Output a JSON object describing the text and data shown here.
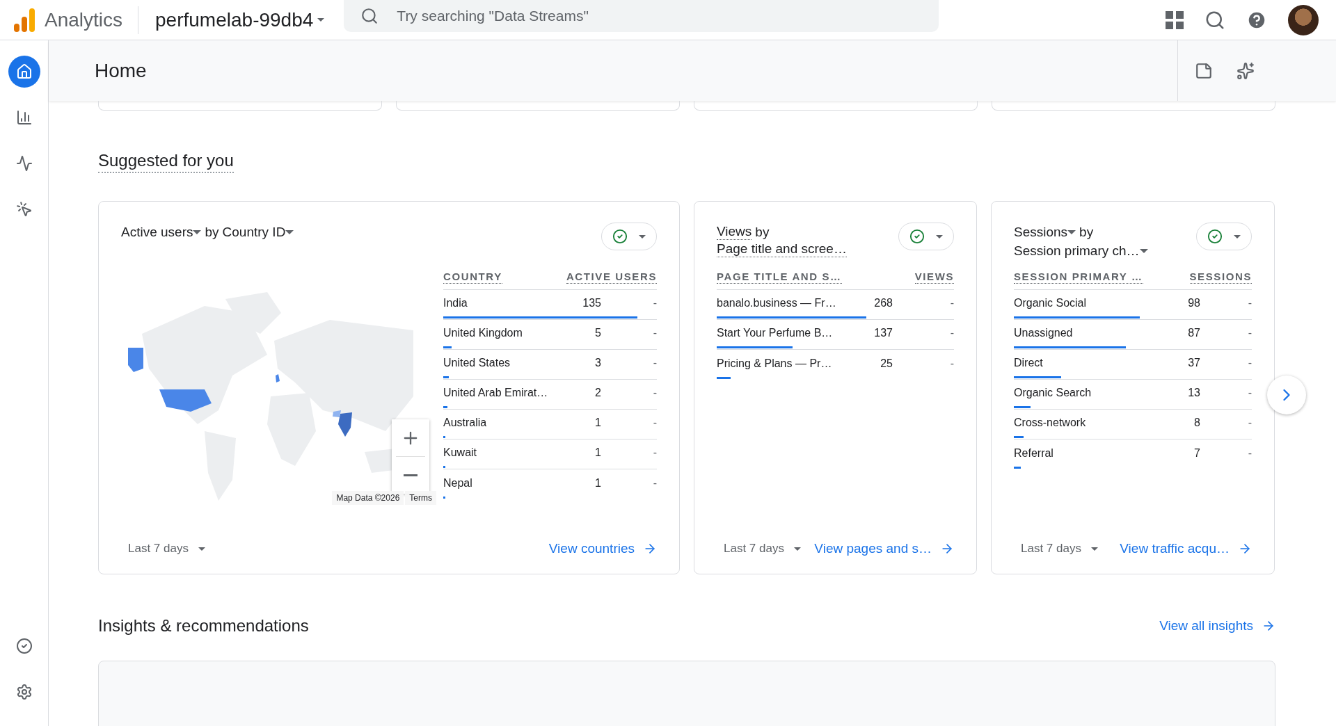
{
  "app": {
    "product": "Analytics",
    "property": "perfumelab-99db4"
  },
  "search": {
    "placeholder": "Try searching \"Data Streams\""
  },
  "rail": {
    "items": [
      {
        "kind": "home",
        "selected": true
      },
      {
        "kind": "reports",
        "selected": false
      },
      {
        "kind": "explore",
        "selected": false
      },
      {
        "kind": "advertising",
        "selected": false
      }
    ],
    "bottom": [
      {
        "kind": "admin-check",
        "selected": false
      },
      {
        "kind": "settings",
        "selected": false
      }
    ]
  },
  "page": {
    "title": "Home"
  },
  "suggested": {
    "heading": "Suggested for you",
    "cards": [
      {
        "kind": "map",
        "title_lines": [
          [
            {
              "text": "Active users",
              "kind": "dropdown"
            },
            {
              "text": "by",
              "kind": "plain"
            },
            {
              "text": "Country ID",
              "kind": "dropdown"
            }
          ]
        ],
        "map_credit": "Map Data ©2026",
        "map_terms": "Terms",
        "columns": [
          "COUNTRY",
          "ACTIVE USERS"
        ],
        "rows": [
          {
            "name": "India",
            "value": "135",
            "change": "-",
            "level": 0.91
          },
          {
            "name": "United Kingdom",
            "value": "5",
            "change": "-",
            "level": 0.04
          },
          {
            "name": "United States",
            "value": "3",
            "change": "-",
            "level": 0.025
          },
          {
            "name": "United Arab Emirat…",
            "value": "2",
            "change": "-",
            "level": 0.02
          },
          {
            "name": "Australia",
            "value": "1",
            "change": "-",
            "level": 0.01
          },
          {
            "name": "Kuwait",
            "value": "1",
            "change": "-",
            "level": 0.01
          },
          {
            "name": "Nepal",
            "value": "1",
            "change": "-",
            "level": 0.01
          }
        ],
        "range": "Last 7 days",
        "link": "View countries"
      },
      {
        "kind": "table",
        "title_lines": [
          [
            {
              "text": "Views",
              "kind": "dotted"
            },
            {
              "text": "by",
              "kind": "plain"
            }
          ],
          [
            {
              "text": "Page title and scree…",
              "kind": "dotted"
            }
          ]
        ],
        "columns": [
          "PAGE TITLE AND S…",
          "VIEWS"
        ],
        "rows": [
          {
            "name": "banalo.business — Fr…",
            "value": "268",
            "change": "-",
            "level": 0.63
          },
          {
            "name": "Start Your Perfume B…",
            "value": "137",
            "change": "-",
            "level": 0.32
          },
          {
            "name": "Pricing & Plans — Pr…",
            "value": "25",
            "change": "-",
            "level": 0.06
          }
        ],
        "range": "Last 7 days",
        "link": "View pages and s…"
      },
      {
        "kind": "table",
        "title_lines": [
          [
            {
              "text": "Sessions",
              "kind": "dropdown"
            },
            {
              "text": "by",
              "kind": "plain"
            }
          ],
          [
            {
              "text": "Session primary ch…",
              "kind": "dropdown"
            }
          ]
        ],
        "columns": [
          "SESSION PRIMARY …",
          "SESSIONS"
        ],
        "rows": [
          {
            "name": "Organic Social",
            "value": "98",
            "change": "-",
            "level": 0.53
          },
          {
            "name": "Unassigned",
            "value": "87",
            "change": "-",
            "level": 0.47
          },
          {
            "name": "Direct",
            "value": "37",
            "change": "-",
            "level": 0.2
          },
          {
            "name": "Organic Search",
            "value": "13",
            "change": "-",
            "level": 0.07
          },
          {
            "name": "Cross-network",
            "value": "8",
            "change": "-",
            "level": 0.04
          },
          {
            "name": "Referral",
            "value": "7",
            "change": "-",
            "level": 0.03
          }
        ],
        "range": "Last 7 days",
        "link": "View traffic acqu…"
      }
    ]
  },
  "insights": {
    "heading": "Insights & recommendations",
    "link": "View all insights"
  }
}
